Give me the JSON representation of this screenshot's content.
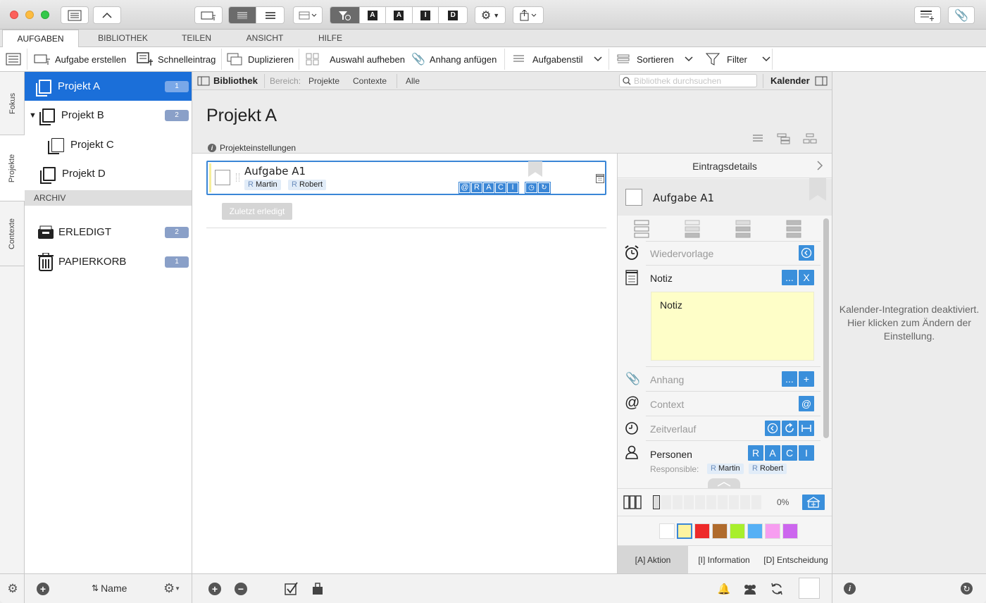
{
  "toolbar": {
    "title_letters": [
      "A",
      "A",
      "I",
      "D"
    ]
  },
  "tabs": [
    "AUFGABEN",
    "BIBLIOTHEK",
    "TEILEN",
    "ANSICHT",
    "HILFE"
  ],
  "ribbon": {
    "create_task": "Aufgabe erstellen",
    "quick_entry": "Schnelleintrag",
    "duplicate": "Duplizieren",
    "deselect": "Auswahl aufheben",
    "attach": "Anhang anfügen",
    "task_style": "Aufgabenstil",
    "sort": "Sortieren",
    "filter": "Filter"
  },
  "side_tabs": [
    "Fokus",
    "Projekte",
    "Contexte"
  ],
  "projects": [
    {
      "name": "Projekt A",
      "count": "1"
    },
    {
      "name": "Projekt B",
      "count": "2"
    },
    {
      "name": "Projekt C",
      "count": ""
    },
    {
      "name": "Projekt D",
      "count": ""
    }
  ],
  "archive": {
    "header": "ARCHIV",
    "done": {
      "name": "ERLEDIGT",
      "count": "2"
    },
    "trash": {
      "name": "PAPIERKORB",
      "count": "1"
    }
  },
  "library_bar": {
    "title": "Bibliothek",
    "scope_label": "Bereich:",
    "scopes": [
      "Projekte",
      "Contexte",
      "Alle"
    ],
    "search_placeholder": "Bibliothek durchsuchen",
    "calendar": "Kalender"
  },
  "main": {
    "title": "Projekt A",
    "settings": "Projekteinstellungen",
    "task": {
      "title": "Aufgabe A1",
      "people": [
        {
          "role": "R",
          "name": "Martin"
        },
        {
          "role": "R",
          "name": "Robert"
        }
      ],
      "raci": [
        "@",
        "R",
        "A",
        "C",
        "I"
      ]
    },
    "recently_done": "Zuletzt erledigt"
  },
  "details": {
    "header": "Eintragsdetails",
    "task_title": "Aufgabe A1",
    "resubmission": "Wiedervorlage",
    "note_label": "Notiz",
    "note_text": "Notiz",
    "note_more": "...",
    "note_delete": "X",
    "attachment": "Anhang",
    "attach_more": "...",
    "attach_add": "+",
    "context": "Context",
    "context_btn": "@",
    "timeline": "Zeitverlauf",
    "persons": "Personen",
    "raci": [
      "R",
      "A",
      "C",
      "I"
    ],
    "responsible_label": "Responsible:",
    "responsible": [
      {
        "role": "R",
        "name": "Martin"
      },
      {
        "role": "R",
        "name": "Robert"
      }
    ],
    "progress": "0%",
    "progress_value": 0,
    "colors": [
      "#ffffff",
      "#fdf3a0",
      "#ee2a2a",
      "#b06b2c",
      "#a8ef2c",
      "#56b0f5",
      "#f79df0",
      "#cc66ee"
    ],
    "bottom_tabs": [
      "[A] Aktion",
      "[I] Information",
      "[D] Entscheidung"
    ]
  },
  "calendar": {
    "message": "Kalender-Integration deaktiviert. Hier klicken zum Ändern der Einstellung."
  },
  "bottom": {
    "sort_label": "Name"
  }
}
